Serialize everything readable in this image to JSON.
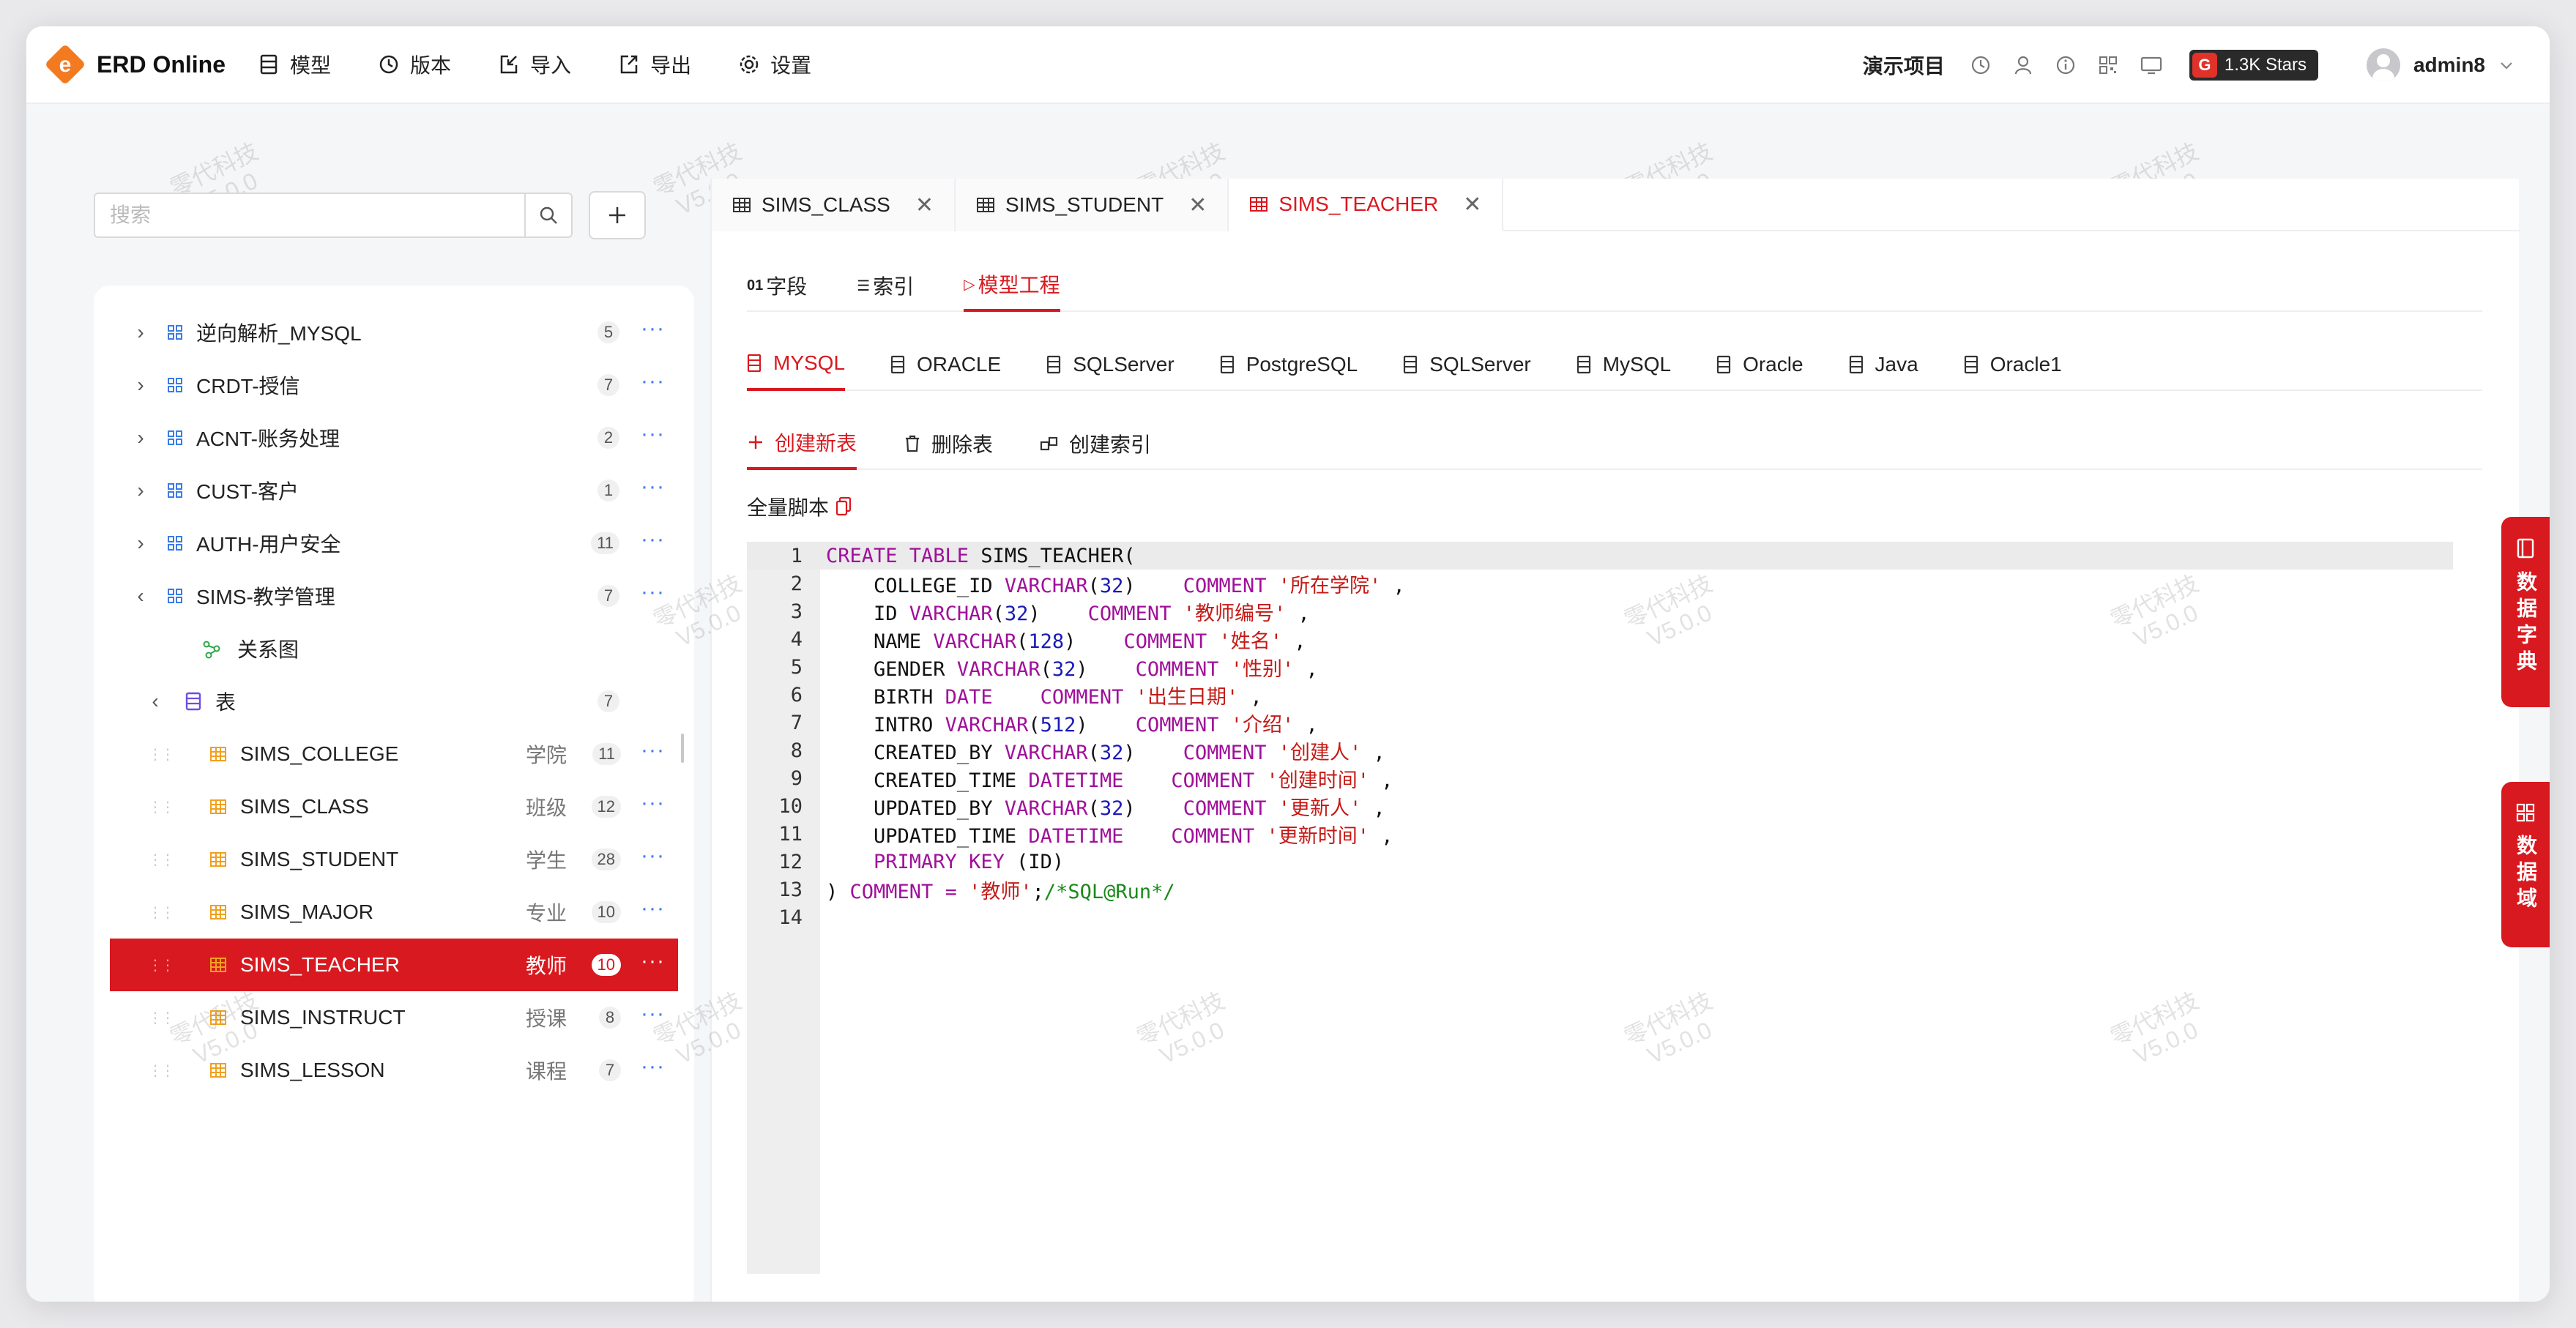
{
  "app": {
    "name": "ERD Online"
  },
  "nav": [
    {
      "label": "模型",
      "icon": "model-icon"
    },
    {
      "label": "版本",
      "icon": "history-icon"
    },
    {
      "label": "导入",
      "icon": "import-icon"
    },
    {
      "label": "导出",
      "icon": "export-icon"
    },
    {
      "label": "设置",
      "icon": "gear-icon"
    }
  ],
  "header_right": {
    "project": "演示项目",
    "stars": "1.3K Stars",
    "user": "admin8"
  },
  "search": {
    "placeholder": "搜索"
  },
  "tree": {
    "groups": [
      {
        "label": "逆向解析_MYSQL",
        "count": "5"
      },
      {
        "label": "CRDT-授信",
        "count": "7"
      },
      {
        "label": "ACNT-账务处理",
        "count": "2"
      },
      {
        "label": "CUST-客户",
        "count": "1"
      },
      {
        "label": "AUTH-用户安全",
        "count": "11"
      },
      {
        "label": "SIMS-教学管理",
        "count": "7"
      }
    ],
    "diagram": "关系图",
    "tables_node": {
      "label": "表",
      "count": "7"
    },
    "tables": [
      {
        "name": "SIMS_COLLEGE",
        "cn": "学院",
        "count": "11"
      },
      {
        "name": "SIMS_CLASS",
        "cn": "班级",
        "count": "12"
      },
      {
        "name": "SIMS_STUDENT",
        "cn": "学生",
        "count": "28"
      },
      {
        "name": "SIMS_MAJOR",
        "cn": "专业",
        "count": "10"
      },
      {
        "name": "SIMS_TEACHER",
        "cn": "教师",
        "count": "10"
      },
      {
        "name": "SIMS_INSTRUCT",
        "cn": "授课",
        "count": "8"
      },
      {
        "name": "SIMS_LESSON",
        "cn": "课程",
        "count": "7"
      }
    ]
  },
  "file_tabs": [
    "SIMS_CLASS",
    "SIMS_STUDENT",
    "SIMS_TEACHER"
  ],
  "sub_tabs": [
    {
      "pre": "01",
      "label": "字段"
    },
    {
      "pre": "☰",
      "label": "索引"
    },
    {
      "pre": "▷",
      "label": "模型工程"
    }
  ],
  "db_tabs": [
    "MYSQL",
    "ORACLE",
    "SQLServer",
    "PostgreSQL",
    "SQLServer",
    "MySQL",
    "Oracle",
    "Java",
    "Oracle1"
  ],
  "actions": [
    "创建新表",
    "删除表",
    "创建索引"
  ],
  "script_label": "全量脚本",
  "code_lines": [
    {
      "n": "1"
    },
    {
      "n": "2"
    },
    {
      "n": "3"
    },
    {
      "n": "4"
    },
    {
      "n": "5"
    },
    {
      "n": "6"
    },
    {
      "n": "7"
    },
    {
      "n": "8"
    },
    {
      "n": "9"
    },
    {
      "n": "10"
    },
    {
      "n": "11"
    },
    {
      "n": "12"
    },
    {
      "n": "13"
    },
    {
      "n": "14"
    }
  ],
  "code": {
    "l1": {
      "kw": "CREATE TABLE",
      "name": " SIMS_TEACHER("
    },
    "l2": {
      "col": "    COLLEGE_ID ",
      "type": "VARCHAR",
      "size": "32",
      "cm": "COMMENT",
      "str": "'所在学院'"
    },
    "l3": {
      "col": "    ID ",
      "type": "VARCHAR",
      "size": "32",
      "cm": "COMMENT",
      "str": "'教师编号'"
    },
    "l4": {
      "col": "    NAME ",
      "type": "VARCHAR",
      "size": "128",
      "cm": "COMMENT",
      "str": "'姓名'"
    },
    "l5": {
      "col": "    GENDER ",
      "type": "VARCHAR",
      "size": "32",
      "cm": "COMMENT",
      "str": "'性别'"
    },
    "l6": {
      "col": "    BIRTH ",
      "type": "DATE",
      "cm": "COMMENT",
      "str": "'出生日期'"
    },
    "l7": {
      "col": "    INTRO ",
      "type": "VARCHAR",
      "size": "512",
      "cm": "COMMENT",
      "str": "'介绍'"
    },
    "l8": {
      "col": "    CREATED_BY ",
      "type": "VARCHAR",
      "size": "32",
      "cm": "COMMENT",
      "str": "'创建人'"
    },
    "l9": {
      "col": "    CREATED_TIME ",
      "type": "DATETIME",
      "cm": "COMMENT",
      "str": "'创建时间'"
    },
    "l10": {
      "col": "    UPDATED_BY ",
      "type": "VARCHAR",
      "size": "32",
      "cm": "COMMENT",
      "str": "'更新人'"
    },
    "l11": {
      "col": "    UPDATED_TIME ",
      "type": "DATETIME",
      "cm": "COMMENT",
      "str": "'更新时间'"
    },
    "l12": {
      "kw": "    PRIMARY KEY",
      "rest": " (ID)"
    },
    "l13": {
      "pre": ") ",
      "cm": "COMMENT",
      "eq": " = ",
      "str": "'教师'",
      "semi": ";",
      "cmt": "/*SQL@Run*/"
    }
  },
  "side_buttons": [
    "数据字典",
    "数据域"
  ],
  "watermark": {
    "line1": "零代科技",
    "line2": "V5.0.0"
  },
  "colors": {
    "accent": "#d8191f",
    "link": "#3a7be6",
    "table_icon": "#f0a020"
  }
}
